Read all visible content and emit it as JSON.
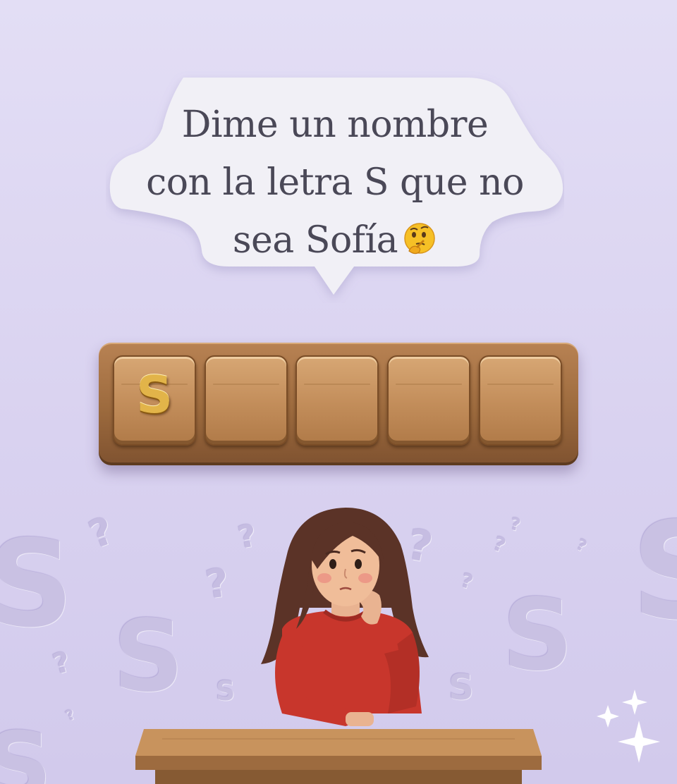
{
  "bubble": {
    "line1": "Dime un nombre",
    "line2": "con la letra S que no",
    "line3": "sea Sofía",
    "emoji": "thinking-face-icon"
  },
  "tiles": [
    "S",
    "",
    "",
    "",
    ""
  ],
  "background_letter": "S",
  "background_question": "?",
  "colors": {
    "background": "#dcd5f2",
    "bubble": "#f1f0f6",
    "wood": "#b07a48",
    "gold_letter": "#e2b449",
    "sweater": "#c8362c"
  }
}
